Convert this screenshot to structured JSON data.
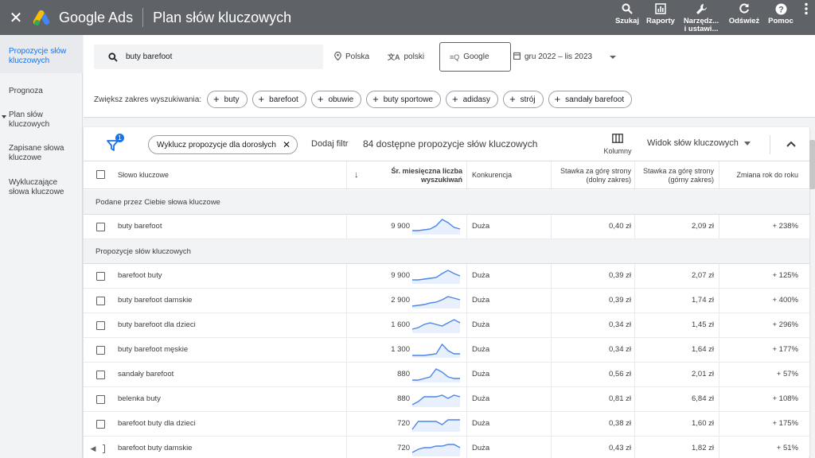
{
  "app": {
    "brand": "Google Ads",
    "page_title": "Plan słów kluczowych",
    "colors": {
      "topbar": "#5f6368",
      "accent": "#1a73e8",
      "spark": "#4a86e8"
    }
  },
  "top_actions": [
    {
      "label": "Szukaj",
      "icon": "search-icon"
    },
    {
      "label": "Raporty",
      "icon": "reports-icon"
    },
    {
      "label": "Narzędz...\ni ustawi...",
      "icon": "tools-icon"
    },
    {
      "label": "Odśwież",
      "icon": "refresh-icon"
    },
    {
      "label": "Pomoc",
      "icon": "help-icon"
    }
  ],
  "sidebar": {
    "items": [
      {
        "label": "Propozycje słów kluczowych",
        "active": true
      },
      {
        "label": "Prognoza"
      },
      {
        "label": "Plan słów kluczowych"
      },
      {
        "label": "Zapisane słowa kluczowe"
      },
      {
        "label": "Wykluczające słowa kluczowe"
      }
    ]
  },
  "search": {
    "query": "buty barefoot",
    "location": "Polska",
    "language": "polski",
    "engine": "Google",
    "date_range": "gru 2022 – lis 2023",
    "broaden_label": "Zwiększ zakres wyszukiwania:",
    "broaden_chips": [
      "buty",
      "barefoot",
      "obuwie",
      "buty sportowe",
      "adidasy",
      "strój",
      "sandały barefoot"
    ]
  },
  "toolbar": {
    "filter_count": "1",
    "exclude_chip": "Wyklucz propozycje dla dorosłych",
    "add_filter": "Dodaj filtr",
    "available": "84 dostępne propozycje słów kluczowych",
    "columns": "Kolumny",
    "view": "Widok słów kluczowych"
  },
  "table": {
    "headers": {
      "keyword": "Słowo kluczowe",
      "searches": "Śr. miesięczna liczba\nwyszukiwań",
      "competition": "Konkurencja",
      "bid_low": "Stawka za górę strony\n(dolny zakres)",
      "bid_high": "Stawka za górę strony\n(górny zakres)",
      "yoy": "Zmiana rok do roku"
    },
    "sections": {
      "provided": "Podane przez Ciebie słowa kluczowe",
      "ideas": "Propozycje słów kluczowych"
    },
    "provided_rows": [
      {
        "keyword": "buty barefoot",
        "searches": "9 900",
        "competition": "Duża",
        "bid_low": "0,40 zł",
        "bid_high": "2,09 zł",
        "yoy": "+ 238%",
        "trend": [
          2,
          2,
          2.5,
          3,
          5,
          9,
          7,
          4,
          3
        ]
      }
    ],
    "idea_rows": [
      {
        "keyword": "barefoot buty",
        "searches": "9 900",
        "competition": "Duża",
        "bid_low": "0,39 zł",
        "bid_high": "2,07 zł",
        "yoy": "+ 125%",
        "trend": [
          2,
          2,
          2.5,
          3,
          3.5,
          6,
          8,
          6,
          4.5
        ]
      },
      {
        "keyword": "buty barefoot damskie",
        "searches": "2 900",
        "competition": "Duża",
        "bid_low": "0,39 zł",
        "bid_high": "1,74 zł",
        "yoy": "+ 400%",
        "trend": [
          1,
          1.5,
          2,
          3,
          3.5,
          5,
          7,
          6,
          5
        ]
      },
      {
        "keyword": "buty barefoot dla dzieci",
        "searches": "1 600",
        "competition": "Duża",
        "bid_low": "0,34 zł",
        "bid_high": "1,45 zł",
        "yoy": "+ 296%",
        "trend": [
          2,
          3,
          5,
          6,
          5,
          4,
          6,
          8,
          6
        ]
      },
      {
        "keyword": "buty barefoot męskie",
        "searches": "1 300",
        "competition": "Duża",
        "bid_low": "0,34 zł",
        "bid_high": "1,64 zł",
        "yoy": "+ 177%",
        "trend": [
          1,
          1,
          1,
          1.5,
          2,
          8,
          4,
          2,
          2
        ]
      },
      {
        "keyword": "sandały barefoot",
        "searches": "880",
        "competition": "Duża",
        "bid_low": "0,56 zł",
        "bid_high": "2,01 zł",
        "yoy": "+ 57%",
        "trend": [
          1,
          1,
          2,
          3,
          8,
          6,
          3,
          2,
          2
        ]
      },
      {
        "keyword": "belenka buty",
        "searches": "880",
        "competition": "Duża",
        "bid_low": "0,81 zł",
        "bid_high": "6,84 zł",
        "yoy": "+ 108%",
        "trend": [
          1,
          3,
          6,
          6,
          6,
          7,
          5,
          7,
          6
        ]
      },
      {
        "keyword": "barefoot buty dla dzieci",
        "searches": "720",
        "competition": "Duża",
        "bid_low": "0,38 zł",
        "bid_high": "1,60 zł",
        "yoy": "+ 175%",
        "trend": [
          1,
          6,
          6,
          6,
          6,
          4,
          7,
          7,
          7
        ]
      },
      {
        "keyword": "barefoot buty damskie",
        "searches": "720",
        "competition": "Duża",
        "bid_low": "0,43 zł",
        "bid_high": "1,82 zł",
        "yoy": "+ 51%",
        "trend": [
          2,
          4,
          5,
          5,
          6,
          6,
          7,
          7,
          5
        ]
      }
    ]
  }
}
